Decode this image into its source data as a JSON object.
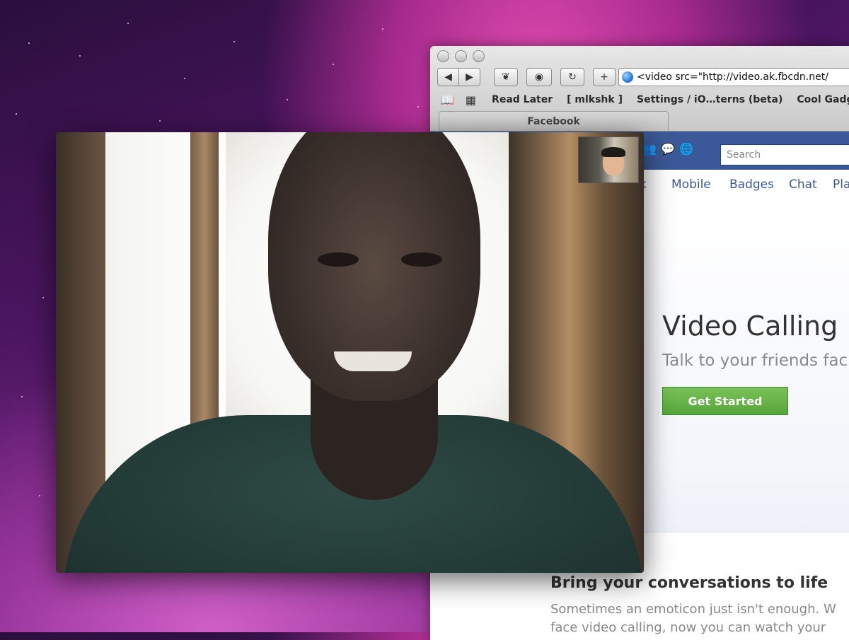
{
  "browser": {
    "toolbar": {
      "back_label": "◀",
      "forward_label": "▶",
      "reload_label": "↻",
      "add_label": "+",
      "url": "<video src=\"http://video.ak.fbcdn.net/"
    },
    "bookmarks": [
      "Read Later",
      "[ mlkshk ]",
      "Settings / iO…terns (beta)",
      "Cool Gadget…"
    ],
    "tab_title": "Facebook"
  },
  "facebook": {
    "search_placeholder": "Search",
    "nav": [
      "k",
      "Mobile",
      "Badges",
      "Chat",
      "Pla"
    ],
    "hero": {
      "title": "Video Calling",
      "subtitle": "Talk to your friends fac",
      "button": "Get Started"
    },
    "section": {
      "title": "Bring your conversations to life",
      "line1": "Sometimes an emoticon just isn't enough. W",
      "line2": "face video calling, now you can watch your"
    }
  },
  "colors": {
    "fb_blue": "#3b5998",
    "fb_link": "#3b5998",
    "button_green": "#5ba83f"
  }
}
